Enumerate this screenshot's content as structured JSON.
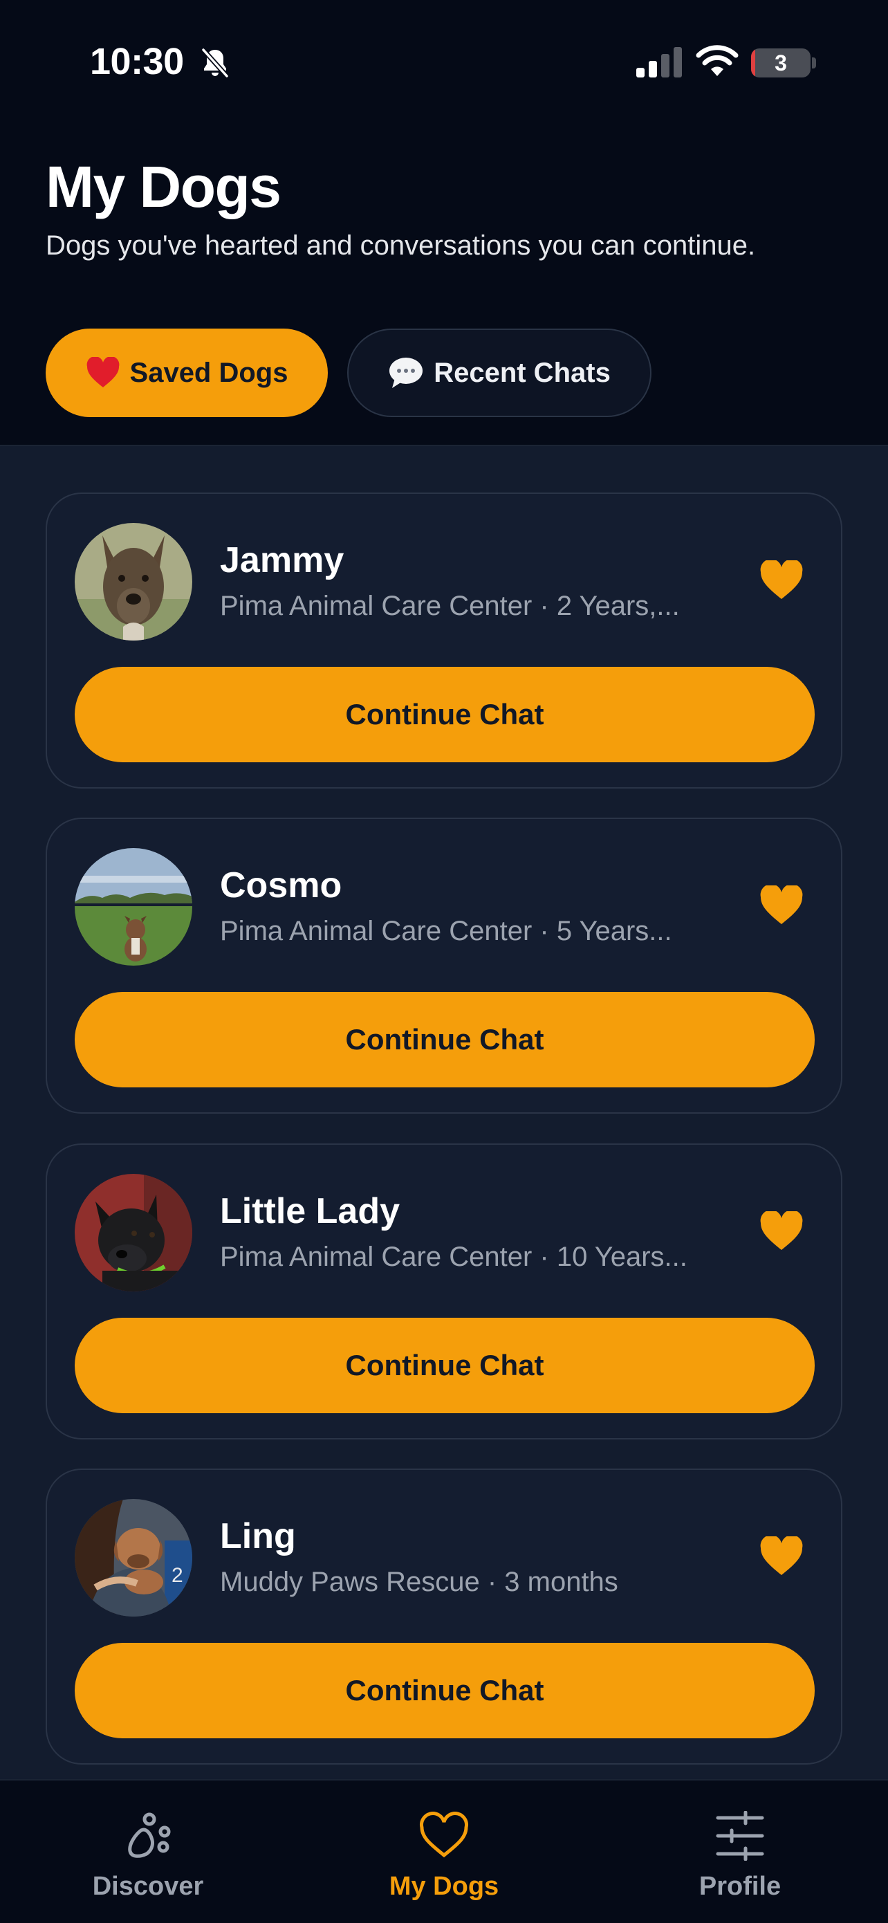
{
  "status_bar": {
    "time": "10:30",
    "battery": "3"
  },
  "header": {
    "title": "My Dogs",
    "subtitle": "Dogs you've hearted and conversations you can continue."
  },
  "tabs": [
    {
      "label": "Saved Dogs",
      "icon": "heart-emoji",
      "active": true
    },
    {
      "label": "Recent Chats",
      "icon": "speech-bubble-emoji",
      "active": false
    }
  ],
  "dogs": [
    {
      "name": "Jammy",
      "meta": "Pima Animal Care Center · 2 Years,...",
      "button": "Continue Chat",
      "hearted": true
    },
    {
      "name": "Cosmo",
      "meta": "Pima Animal Care Center · 5 Years...",
      "button": "Continue Chat",
      "hearted": true
    },
    {
      "name": "Little Lady",
      "meta": "Pima Animal Care Center · 10 Years...",
      "button": "Continue Chat",
      "hearted": true
    },
    {
      "name": "Ling",
      "meta": "Muddy Paws Rescue · 3 months",
      "button": "Continue Chat",
      "hearted": true
    }
  ],
  "nav": [
    {
      "label": "Discover",
      "icon": "paw-icon",
      "active": false
    },
    {
      "label": "My Dogs",
      "icon": "heart-outline-icon",
      "active": true
    },
    {
      "label": "Profile",
      "icon": "sliders-icon",
      "active": false
    }
  ],
  "colors": {
    "accent": "#f59e0b",
    "background": "#131c2e",
    "header_bg": "#050a17",
    "muted_text": "#9ca3af"
  }
}
